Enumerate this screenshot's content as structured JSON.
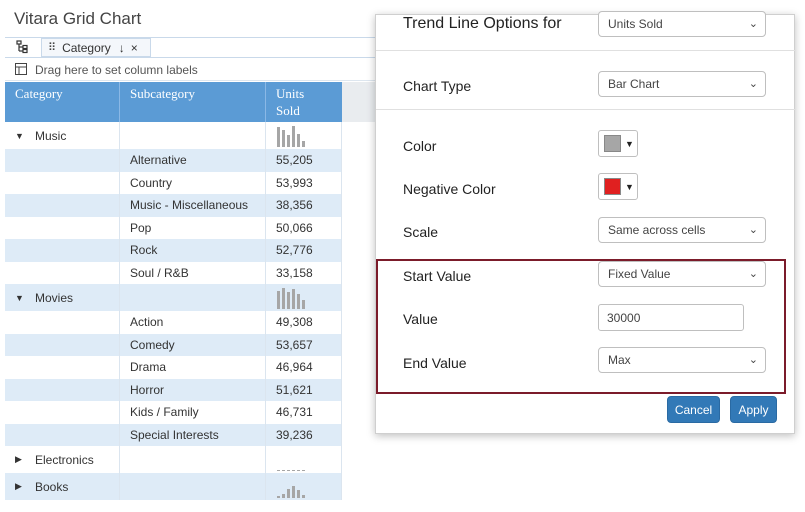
{
  "app": {
    "title": "Vitara Grid Chart"
  },
  "toolbar": {
    "tree_icon": "tree-structure-icon",
    "chip": {
      "label": "Category",
      "grid_icon": "grid-dots-icon",
      "sort_icon": "arrow-down-icon",
      "remove_icon": "close-icon"
    },
    "drop_hint": "Drag here to set column labels"
  },
  "grid": {
    "headers": [
      "Category",
      "Subcategory",
      "Units Sold"
    ],
    "groups": [
      {
        "name": "Music",
        "expanded": true,
        "spark": [
          0.9,
          0.75,
          0.55,
          0.95,
          0.6,
          0.25
        ],
        "rows": [
          {
            "sub": "Alternative",
            "value": "55,205"
          },
          {
            "sub": "Country",
            "value": "53,993"
          },
          {
            "sub": "Music - Miscellaneous",
            "value": "38,356"
          },
          {
            "sub": "Pop",
            "value": "50,066"
          },
          {
            "sub": "Rock",
            "value": "52,776"
          },
          {
            "sub": "Soul / R&B",
            "value": "33,158"
          }
        ]
      },
      {
        "name": "Movies",
        "expanded": true,
        "spark": [
          0.8,
          0.95,
          0.75,
          0.9,
          0.7,
          0.4
        ],
        "rows": [
          {
            "sub": "Action",
            "value": "49,308"
          },
          {
            "sub": "Comedy",
            "value": "53,657"
          },
          {
            "sub": "Drama",
            "value": "46,964"
          },
          {
            "sub": "Horror",
            "value": "51,621"
          },
          {
            "sub": "Kids / Family",
            "value": "46,731"
          },
          {
            "sub": "Special Interests",
            "value": "39,236"
          }
        ]
      },
      {
        "name": "Electronics",
        "expanded": false,
        "spark": [
          0.05,
          0.05,
          0.05,
          0.05,
          0.05,
          0.05
        ],
        "rows": []
      },
      {
        "name": "Books",
        "expanded": false,
        "spark": [
          0.1,
          0.2,
          0.4,
          0.55,
          0.35,
          0.15
        ],
        "rows": []
      }
    ]
  },
  "dialog": {
    "title": "Trend Line Options for",
    "measure_select": "Units Sold",
    "chart_type": {
      "label": "Chart Type",
      "value": "Bar Chart"
    },
    "color": {
      "label": "Color",
      "swatch": "#a6a6a6"
    },
    "negative_color": {
      "label": "Negative Color",
      "swatch": "#e02020"
    },
    "scale": {
      "label": "Scale",
      "value": "Same across cells"
    },
    "start_value": {
      "label": "Start Value",
      "value": "Fixed Value"
    },
    "value": {
      "label": "Value",
      "value": "30000"
    },
    "end_value": {
      "label": "End Value",
      "value": "Max"
    },
    "cancel_label": "Cancel",
    "apply_label": "Apply"
  },
  "colors": {
    "header_blue": "#5b9bd5",
    "alt_row": "#deebf7",
    "button_blue": "#3279b7",
    "highlight_border": "#7b1b2a"
  }
}
